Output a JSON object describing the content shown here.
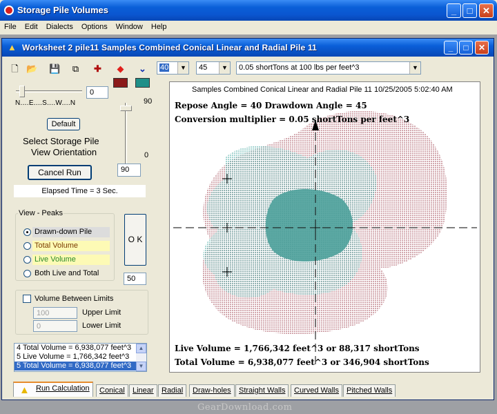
{
  "app": {
    "title": "Storage Pile Volumes"
  },
  "menu": [
    "File",
    "Edit",
    "Dialects",
    "Options",
    "Window",
    "Help"
  ],
  "worksheet": {
    "title": "Worksheet 2  pile11  Samples  Combined Conical  Linear and Radial  Pile 11"
  },
  "toolbar": {
    "repose_value": "40",
    "drawdown_value": "45",
    "conversion_value": "0.05 shortTons at 100 lbs per feet^3"
  },
  "colors": {
    "swatch1": "#8b1a1a",
    "swatch2": "#1f8f88",
    "live": "#2a9a94",
    "total": "#8b1a2a"
  },
  "orientation": {
    "slider_value": "0",
    "compass_label": "N....E....S....W....N",
    "elev_top": "90",
    "elev_bottom": "0",
    "elev_value": "90",
    "default_label": "Default",
    "select_label_1": "Select Storage Pile",
    "select_label_2": "View Orientation"
  },
  "run": {
    "cancel_label": "Cancel Run",
    "elapsed": "Elapsed Time = 3 Sec."
  },
  "view": {
    "legend": "View - Peaks",
    "options": [
      "Drawn-down Pile",
      "Total Volume",
      "Live Volume",
      "Both Live and Total"
    ],
    "ok_label": "O K",
    "peaks_value": "50"
  },
  "limits": {
    "check_label": "Volume Between Limits",
    "upper_value": "100",
    "upper_label": "Upper Limit",
    "lower_value": "0",
    "lower_label": "Lower Limit"
  },
  "results": [
    "4 Total Volume = 6,938,077 feet^3",
    "5 Live Volume = 1,766,342 feet^3",
    "5 Total Volume = 6,938,077 feet^3"
  ],
  "plot": {
    "header": "Samples  Combined Conical  Linear and Radial  Pile 11  10/25/2005 5:02:40 AM",
    "repose_line": "Repose Angle =  40    Drawdown Angle = 45",
    "conversion_line": "Conversion multiplier = 0.05 shortTons per feet^3",
    "live_line": "Live Volume = 1,766,342  feet^3  or 88,317 shortTons",
    "total_line": "Total Volume = 6,938,077  feet^3  or 346,904 shortTons"
  },
  "tabs": [
    "Run Calculation",
    "Conical",
    "Linear",
    "Radial",
    "Draw-holes",
    "Straight Walls",
    "Curved Walls",
    "Pitched Walls"
  ],
  "watermark": "GearDownload.com"
}
